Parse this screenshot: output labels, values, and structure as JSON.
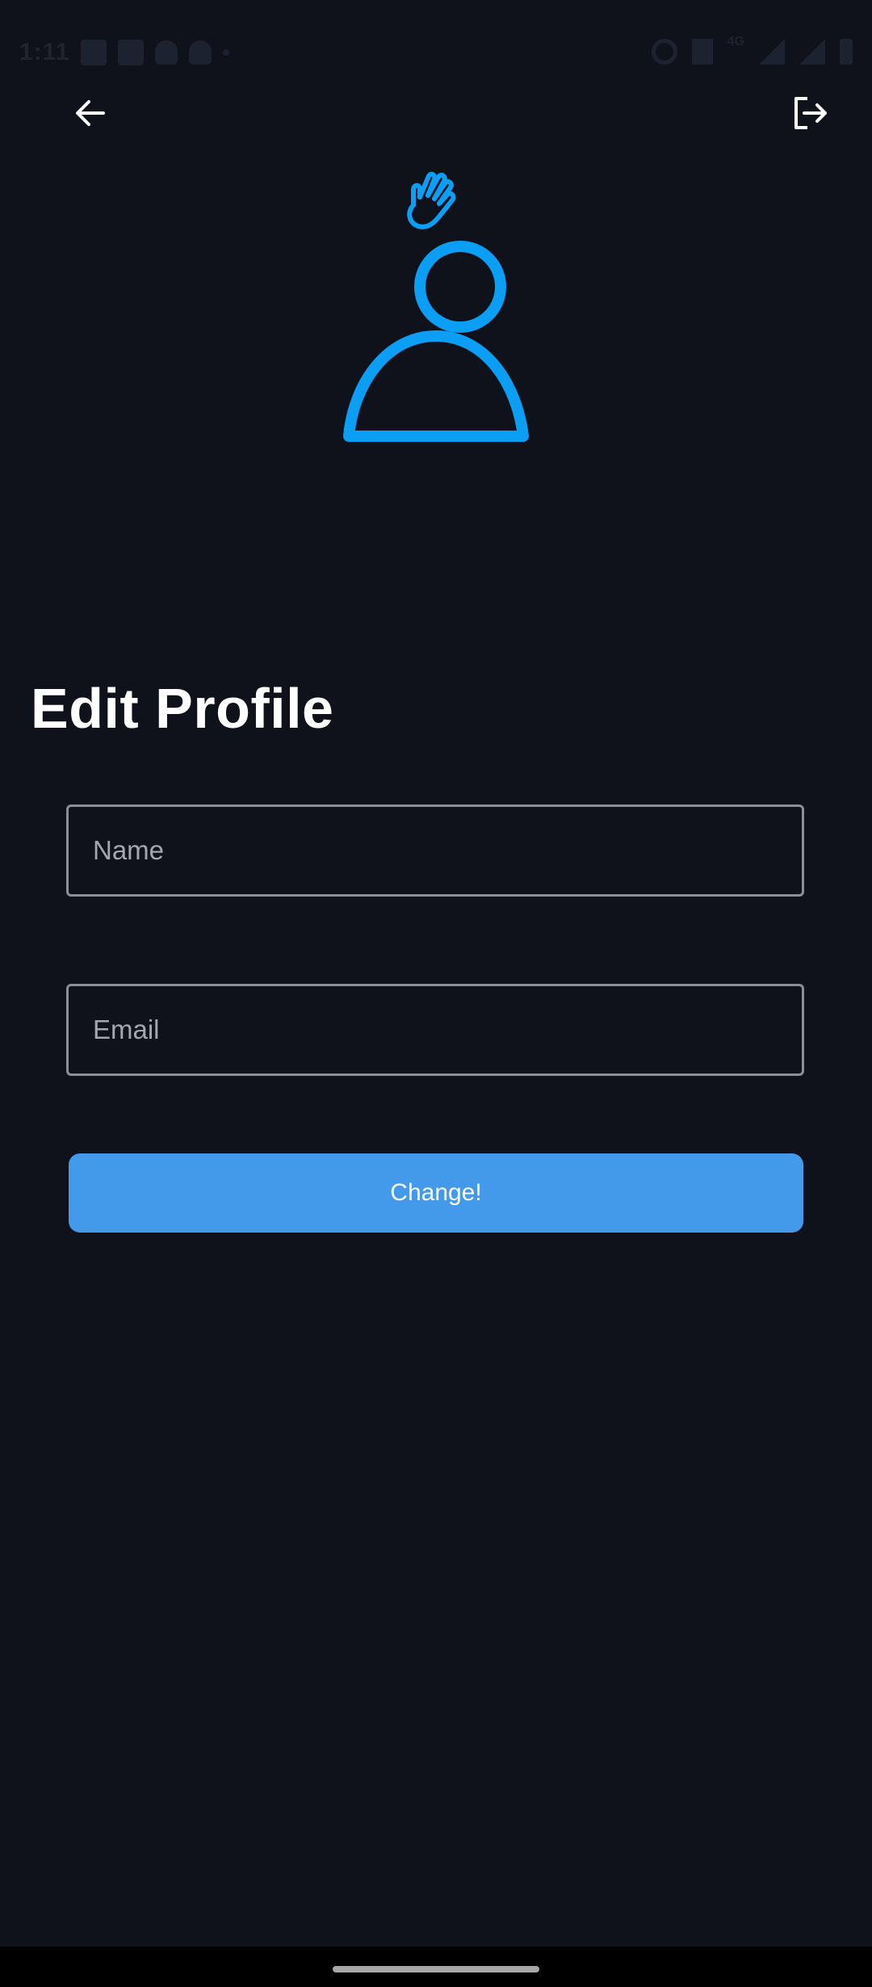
{
  "status_bar": {
    "time": "1:11",
    "network": "4G"
  },
  "header": {
    "back_icon": "arrow-left-icon",
    "logout_icon": "logout-icon"
  },
  "illustration": {
    "hand_icon": "waving-hand-icon",
    "person_icon": "person-icon",
    "accent_color": "#0a9ef5"
  },
  "page": {
    "title": "Edit Profile"
  },
  "form": {
    "name_placeholder": "Name",
    "name_value": "",
    "email_placeholder": "Email",
    "email_value": "",
    "submit_label": "Change!",
    "button_color": "#4399ea"
  },
  "colors": {
    "background": "#0f121b",
    "field_border": "#8b8f99"
  }
}
